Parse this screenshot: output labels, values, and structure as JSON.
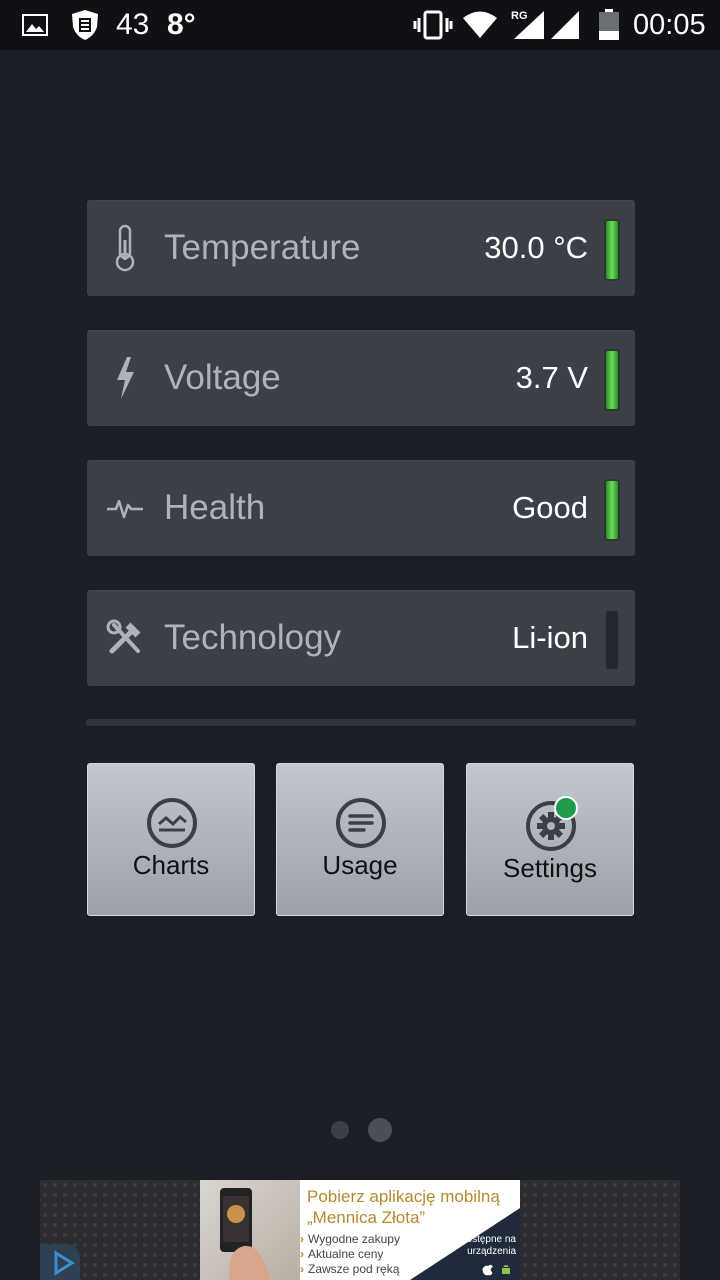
{
  "status_bar": {
    "notification_count": "43",
    "weather_temp": "8°",
    "network_label": "RG",
    "time": "00:05",
    "icons": [
      "image-icon",
      "shield-icon",
      "vibrate-icon",
      "wifi-icon",
      "signal-icon",
      "signal-icon-2",
      "battery-icon"
    ]
  },
  "cards": [
    {
      "icon": "thermometer-icon",
      "label": "Temperature",
      "value": "30.0 °C",
      "indicator": "on"
    },
    {
      "icon": "lightning-icon",
      "label": "Voltage",
      "value": "3.7 V",
      "indicator": "on"
    },
    {
      "icon": "heartbeat-icon",
      "label": "Health",
      "value": "Good",
      "indicator": "on"
    },
    {
      "icon": "tools-icon",
      "label": "Technology",
      "value": "Li-ion",
      "indicator": "off"
    }
  ],
  "buttons": {
    "charts": "Charts",
    "usage": "Usage",
    "settings": "Settings"
  },
  "pager": {
    "pages": 2,
    "current": 2
  },
  "ad": {
    "title": "Pobierz aplikację mobilną „Mennica Złota”",
    "bullets": [
      "Wygodne zakupy",
      "Aktualne ceny",
      "Zawsze pod ręką"
    ],
    "availability": "Dostępne na urządzenia"
  },
  "colors": {
    "background": "#1b1e25",
    "card": "#3a3f48",
    "indicator_on": "#4fd14a",
    "button": "#b0b4bc",
    "badge": "#1f9a4a",
    "ad_accent": "#b48a2e"
  }
}
